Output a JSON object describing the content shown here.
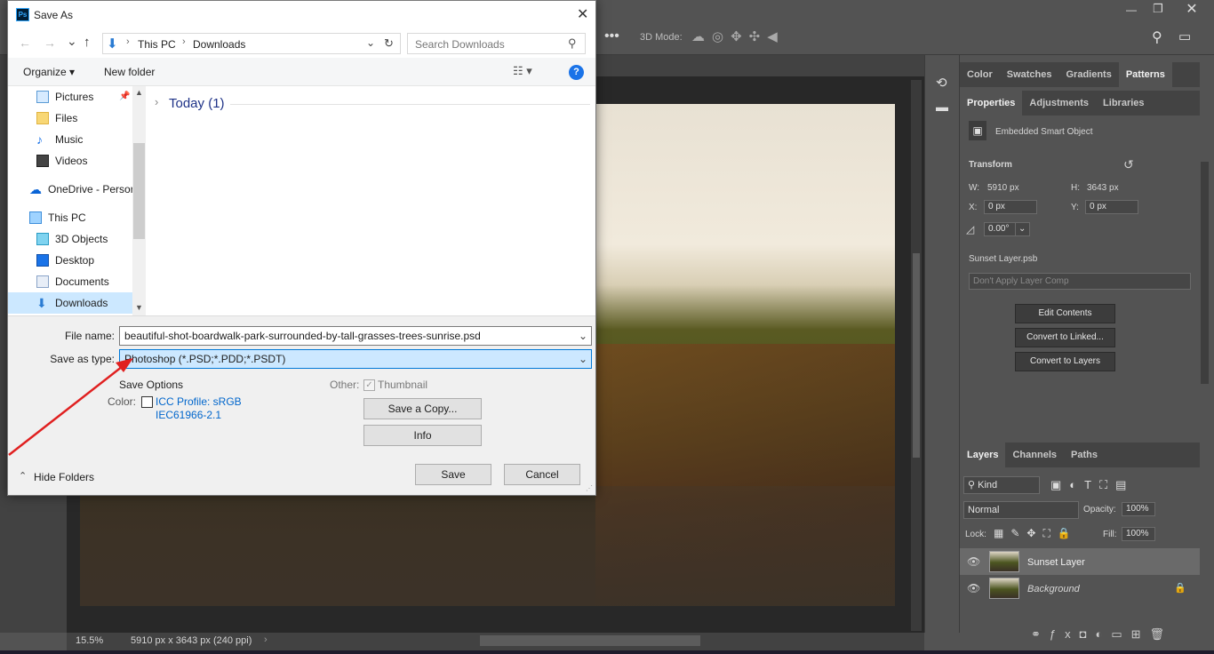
{
  "dialog": {
    "title": "Save As",
    "address": {
      "this_pc": "This PC",
      "folder": "Downloads"
    },
    "search_placeholder": "Search Downloads",
    "commands": {
      "organize": "Organize",
      "new_folder": "New folder"
    },
    "nav": [
      {
        "label": "Pictures",
        "icon": "pictures-icon",
        "pinned": true
      },
      {
        "label": "Files",
        "icon": "folder-icon"
      },
      {
        "label": "Music",
        "icon": "music-icon"
      },
      {
        "label": "Videos",
        "icon": "videos-icon"
      },
      {
        "label": "OneDrive - Persor",
        "icon": "onedrive-icon"
      },
      {
        "label": "This PC",
        "icon": "this-pc-icon"
      },
      {
        "label": "3D Objects",
        "icon": "3d-objects-icon"
      },
      {
        "label": "Desktop",
        "icon": "desktop-icon"
      },
      {
        "label": "Documents",
        "icon": "documents-icon"
      },
      {
        "label": "Downloads",
        "icon": "downloads-icon",
        "selected": true
      }
    ],
    "group_header": "Today (1)",
    "file_name_label": "File name:",
    "file_name": "beautiful-shot-boardwalk-park-surrounded-by-tall-grasses-trees-sunrise.psd",
    "save_type_label": "Save as type:",
    "save_type": "Photoshop (*.PSD;*.PDD;*.PSDT)",
    "save_options": "Save Options",
    "color_label": "Color:",
    "icc_profile": "ICC Profile:  sRGB",
    "icc_profile_2": "IEC61966-2.1",
    "other_label": "Other:",
    "thumbnail": "Thumbnail",
    "save_copy": "Save a Copy...",
    "info": "Info",
    "hide_folders": "Hide Folders",
    "save": "Save",
    "cancel": "Cancel"
  },
  "ps": {
    "options_3d": "3D Mode:",
    "status_zoom": "15.5%",
    "status_info": "5910 px x 3643 px (240 ppi)",
    "tabs_top": [
      "Color",
      "Swatches",
      "Gradients",
      "Patterns"
    ],
    "tabs_props": [
      "Properties",
      "Adjustments",
      "Libraries"
    ],
    "smart_object": "Embedded Smart Object",
    "transform": "Transform",
    "w_label": "W:",
    "w": "5910 px",
    "h_label": "H:",
    "h": "3643 px",
    "x_label": "X:",
    "x": "0 px",
    "y_label": "Y:",
    "y": "0 px",
    "angle": "0.00°",
    "linked_file": "Sunset Layer.psb",
    "layer_comp": "Don't Apply Layer Comp",
    "edit_contents": "Edit Contents",
    "convert_linked": "Convert to Linked...",
    "convert_layers": "Convert to Layers",
    "tabs_layers": [
      "Layers",
      "Channels",
      "Paths"
    ],
    "kind": "Kind",
    "blend": "Normal",
    "opacity_label": "Opacity:",
    "opacity": "100%",
    "lock_label": "Lock:",
    "fill_label": "Fill:",
    "fill": "100%",
    "layers": [
      {
        "name": "Sunset Layer"
      },
      {
        "name": "Background"
      }
    ]
  }
}
